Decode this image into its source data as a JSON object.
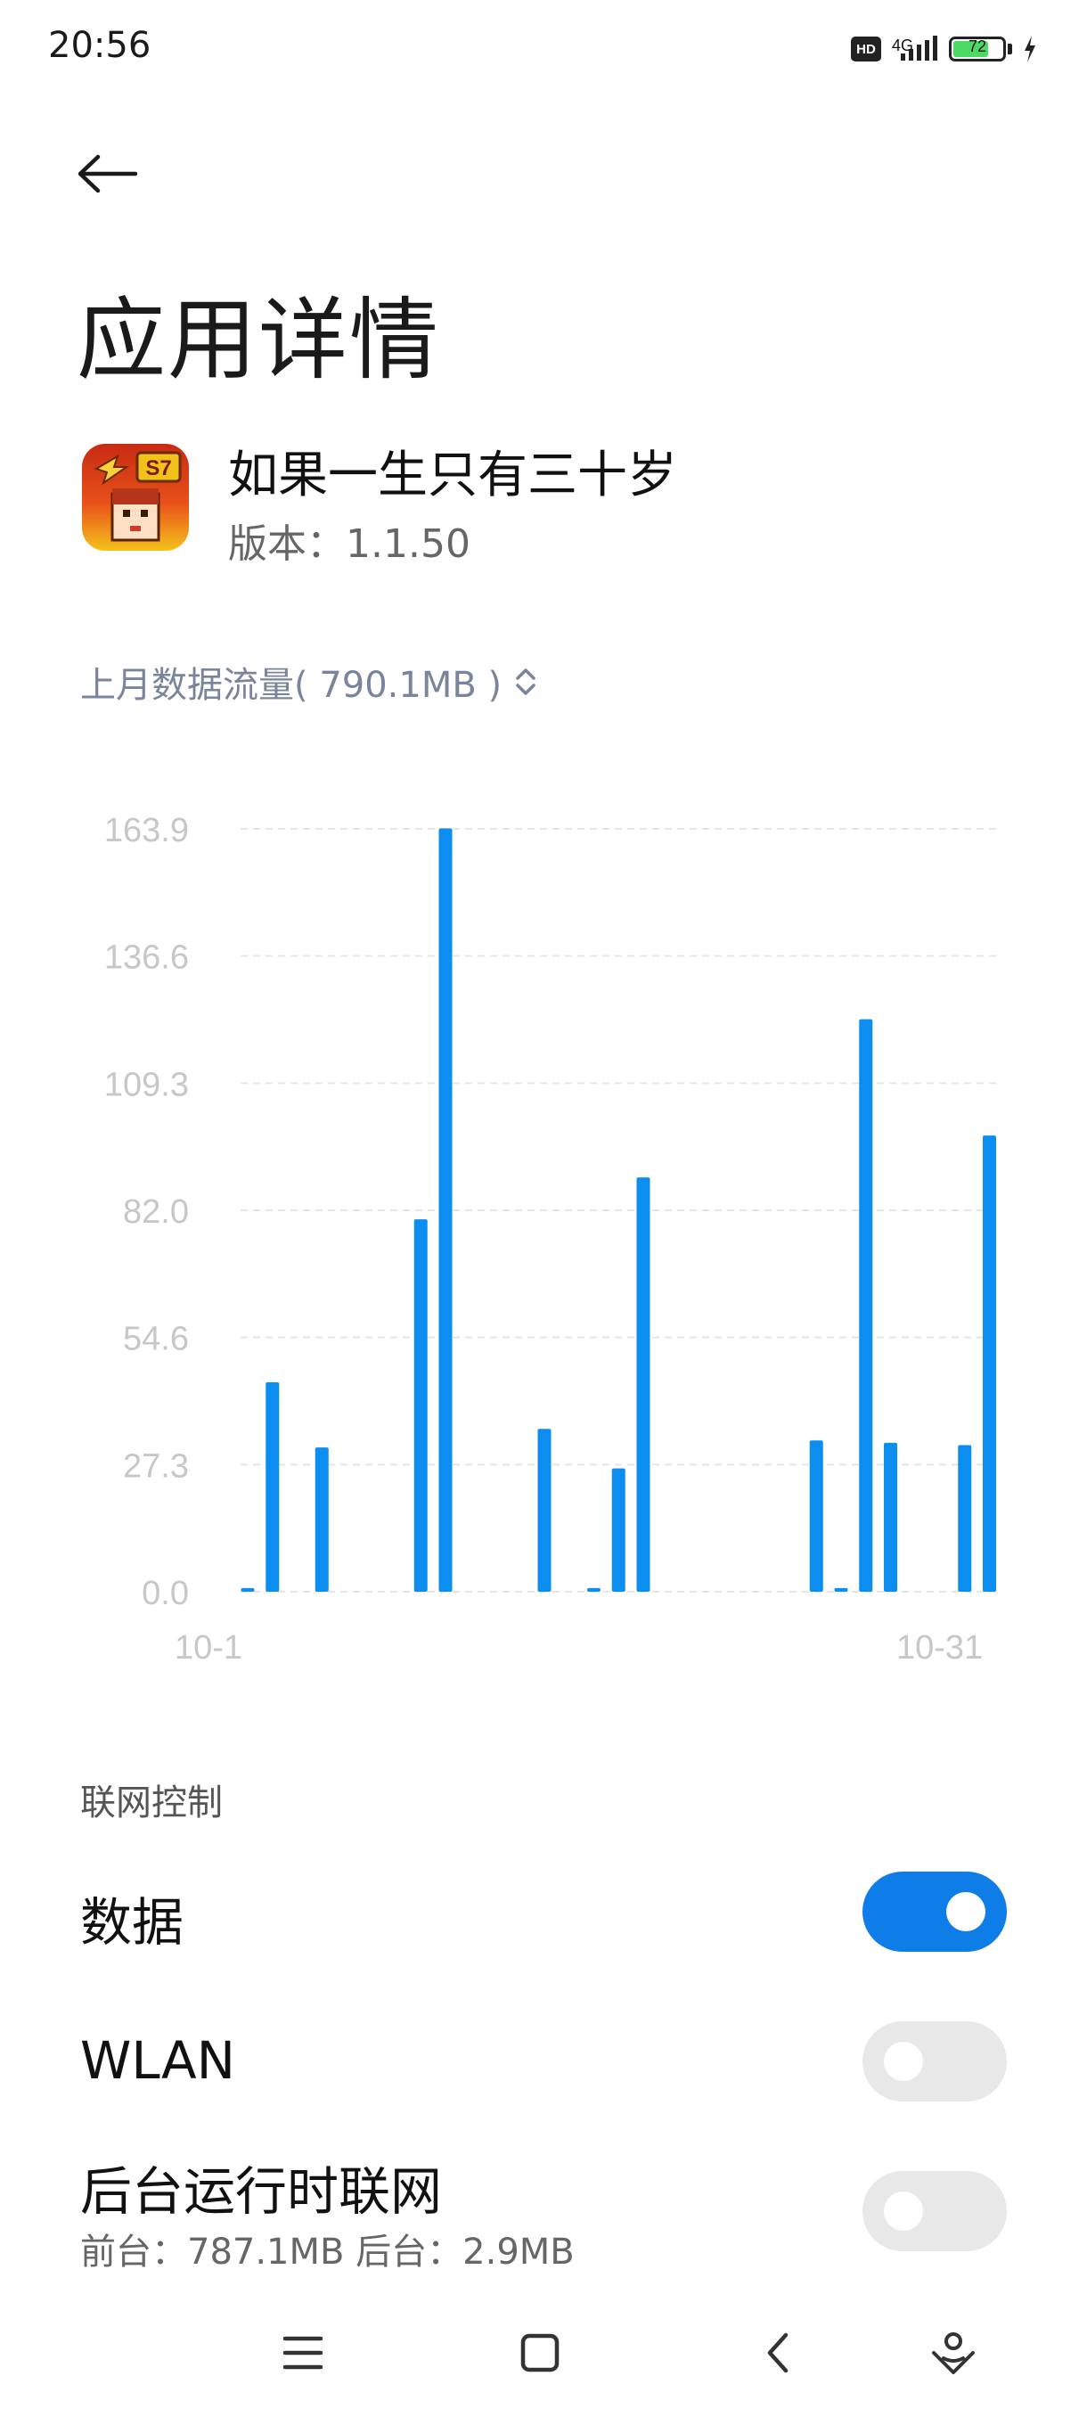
{
  "status_bar": {
    "time": "20:56",
    "hd_label": "HD",
    "network_label": "4G",
    "battery_level": "72",
    "battery_fraction": 0.72,
    "colors": {
      "battery_fill": "#4cd964"
    }
  },
  "header": {
    "back_icon": "arrow-left-icon",
    "title": "应用详情"
  },
  "app": {
    "name": "如果一生只有三十岁",
    "version": "版本：1.1.50",
    "icon_badge": "S7"
  },
  "usage_selector": {
    "label": "上月数据流量( 790.1MB )",
    "icon": "chevron-up-down-icon"
  },
  "chart_data": {
    "type": "bar",
    "x_start_label": "10-1",
    "x_end_label": "10-31",
    "y_ticks": [
      "163.9",
      "136.6",
      "109.3",
      "82.0",
      "54.6",
      "27.3",
      "0.0"
    ],
    "ylim": [
      0,
      163.9
    ],
    "grid": true,
    "bar_color": "#0b8ef0",
    "days": [
      1,
      2,
      3,
      4,
      5,
      6,
      7,
      8,
      9,
      10,
      11,
      12,
      13,
      14,
      15,
      16,
      17,
      18,
      19,
      20,
      21,
      22,
      23,
      24,
      25,
      26,
      27,
      28,
      29,
      30,
      31
    ],
    "values": [
      0.8,
      45,
      0,
      31,
      0,
      0,
      0,
      80,
      164,
      0,
      0,
      0,
      35,
      0,
      0.8,
      26.5,
      89,
      0,
      0,
      0,
      0,
      0,
      0,
      32.5,
      0.8,
      123,
      32,
      0,
      0,
      31.5,
      98
    ]
  },
  "network_control": {
    "section_label": "联网控制",
    "rows": [
      {
        "label": "数据",
        "on": true
      },
      {
        "label": "WLAN",
        "on": false
      },
      {
        "label": "后台运行时联网",
        "sub": "前台：787.1MB  后台：2.9MB",
        "on": false
      }
    ]
  },
  "nav_bar": {
    "menu_icon": "menu-icon",
    "home_icon": "home-square-icon",
    "back_icon": "back-chevron-icon",
    "assistant_icon": "assistant-icon"
  },
  "colors": {
    "accent": "#0f7de8",
    "toggle_off": "#e8e8e8",
    "selector_text": "#7a849b"
  }
}
